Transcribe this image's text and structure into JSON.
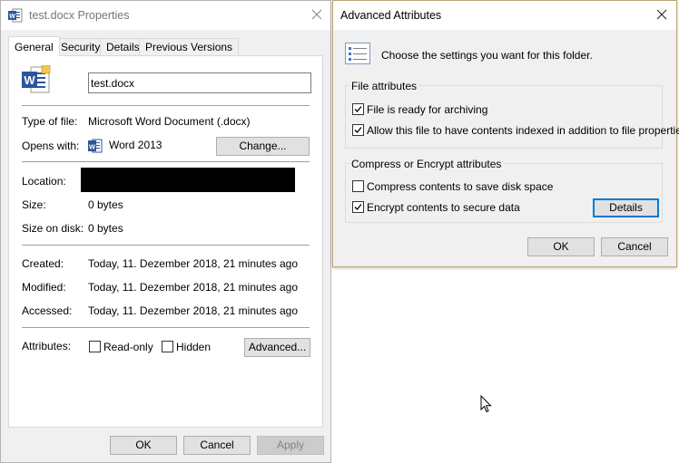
{
  "properties": {
    "title": "test.docx Properties",
    "tabs": [
      {
        "label": "General"
      },
      {
        "label": "Security"
      },
      {
        "label": "Details"
      },
      {
        "label": "Previous Versions"
      }
    ],
    "filename": "test.docx",
    "type_label": "Type of file:",
    "type_value": "Microsoft Word Document (.docx)",
    "opens_label": "Opens with:",
    "opens_value": "Word 2013",
    "change_button": "Change...",
    "location_label": "Location:",
    "size_label": "Size:",
    "size_value": "0 bytes",
    "size_on_disk_label": "Size on disk:",
    "size_on_disk_value": "0 bytes",
    "created_label": "Created:",
    "created_value": "Today, 11. Dezember 2018, 21 minutes ago",
    "modified_label": "Modified:",
    "modified_value": "Today, 11. Dezember 2018, 21 minutes ago",
    "accessed_label": "Accessed:",
    "accessed_value": "Today, 11. Dezember 2018, 21 minutes ago",
    "attributes_label": "Attributes:",
    "readonly_label": "Read-only",
    "hidden_label": "Hidden",
    "advanced_button": "Advanced...",
    "ok_button": "OK",
    "cancel_button": "Cancel",
    "apply_button": "Apply"
  },
  "advanced": {
    "title": "Advanced Attributes",
    "description": "Choose the settings you want for this folder.",
    "file_attributes_title": "File attributes",
    "archive_label": "File is ready for archiving",
    "index_label": "Allow this file to have contents indexed in addition to file properties",
    "compress_title": "Compress or Encrypt attributes",
    "compress_label": "Compress contents to save disk space",
    "encrypt_label": "Encrypt contents to secure data",
    "details_button": "Details",
    "ok_button": "OK",
    "cancel_button": "Cancel"
  },
  "colors": {
    "word_blue": "#2b579a",
    "focus_blue": "#0078d7"
  }
}
